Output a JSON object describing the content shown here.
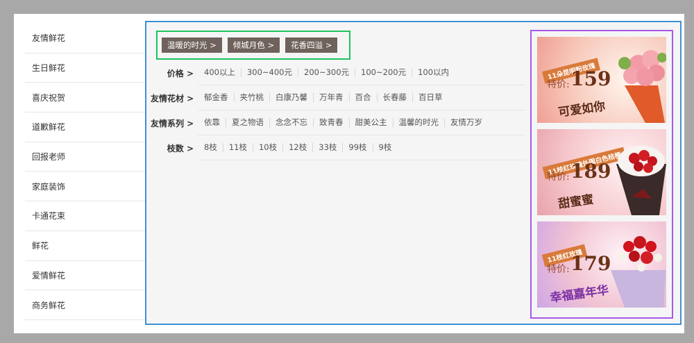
{
  "sidebar": {
    "items": [
      "友情鲜花",
      "生日鲜花",
      "喜庆祝贺",
      "道歉鲜花",
      "回报老师",
      "家庭装饰",
      "卡通花束",
      "鲜花",
      "爱情鲜花",
      "商务鲜花"
    ]
  },
  "breadcrumbs": [
    "温暖的时光 >",
    "倾城月色 >",
    "花香四溢 >"
  ],
  "filters": [
    {
      "label": "价格 >",
      "options": [
        "400以上",
        "300~400元",
        "200~300元",
        "100~200元",
        "100以内"
      ]
    },
    {
      "label": "友情花材 >",
      "options": [
        "郁金香",
        "夹竹桃",
        "白康乃馨",
        "万年青",
        "百合",
        "长春藤",
        "百日草"
      ]
    },
    {
      "label": "友情系列 >",
      "options": [
        "依靠",
        "夏之物语",
        "念念不忘",
        "致青春",
        "甜美公主",
        "温馨的时光",
        "友情万岁"
      ]
    },
    {
      "label": "枝数 >",
      "options": [
        "8枝",
        "11枝",
        "10枝",
        "12枝",
        "33枝",
        "99枝",
        "9枝"
      ]
    }
  ],
  "ads": [
    {
      "tag": "11朵昆明粉玫瑰",
      "price_label": "特价:",
      "price": "159",
      "name": "可爱如你"
    },
    {
      "tag": "11枝红玫瑰外围白色桔梗",
      "price_label": "特价:",
      "price": "189",
      "name": "甜蜜蜜"
    },
    {
      "tag": "11枝红玫瑰",
      "price_label": "特价:",
      "price": "179",
      "name": "幸福嘉年华"
    }
  ],
  "colors": {
    "main_border": "#3d8fd6",
    "crumb_border": "#1cc35b",
    "ads_border": "#a856e8",
    "crumb_bg": "#6f615b"
  }
}
